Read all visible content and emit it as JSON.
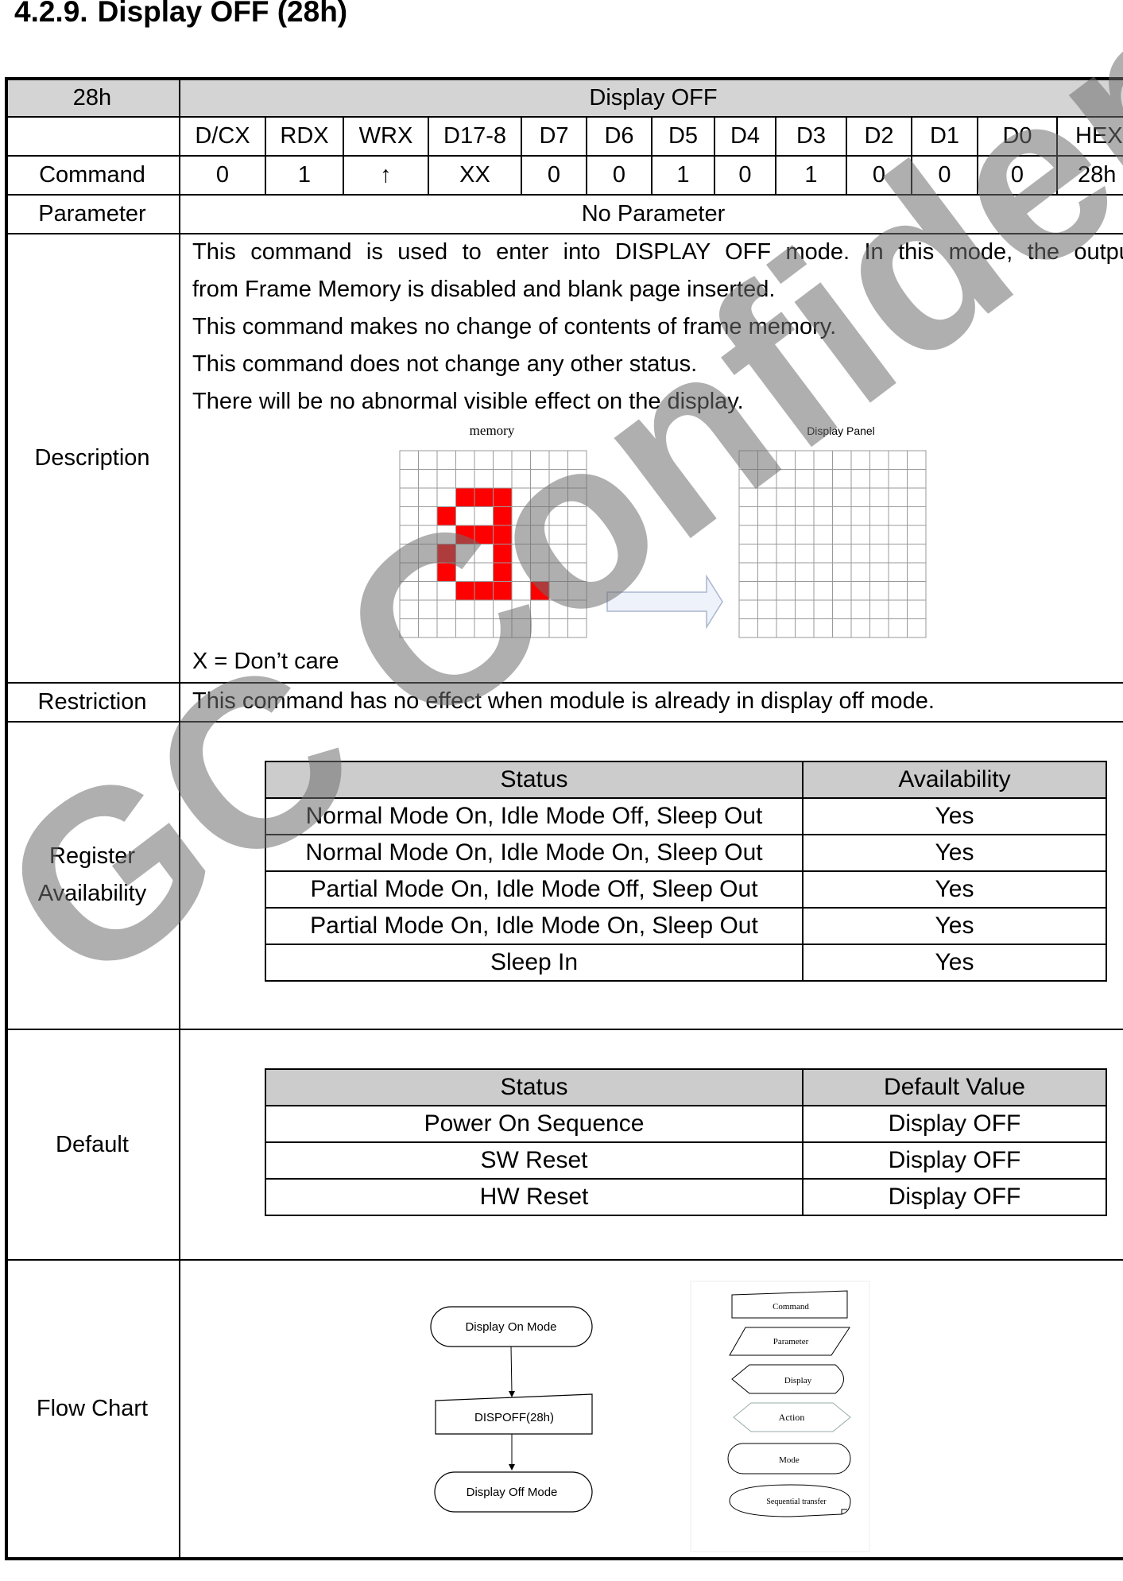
{
  "heading": {
    "number": "4.2.9.",
    "title": "Display OFF (28h)"
  },
  "header_row": {
    "code": "28h",
    "name": "Display OFF"
  },
  "bit_headers": [
    "D/CX",
    "RDX",
    "WRX",
    "D17-8",
    "D7",
    "D6",
    "D5",
    "D4",
    "D3",
    "D2",
    "D1",
    "D0",
    "HEX"
  ],
  "command_row": {
    "label": "Command",
    "values": [
      "0",
      "1",
      "↑",
      "XX",
      "0",
      "0",
      "1",
      "0",
      "1",
      "0",
      "0",
      "0",
      "28h"
    ]
  },
  "parameter_row": {
    "label": "Parameter",
    "value": "No Parameter"
  },
  "description": {
    "label": "Description",
    "lines": [
      "This command is used to enter into DISPLAY OFF mode. In this mode, the output",
      "from Frame Memory is disabled and blank page inserted.",
      "This command makes no change of contents of frame memory.",
      "This command does not change any other status.",
      "There will be no abnormal visible effect on the display."
    ],
    "memory_label": "memory",
    "panel_label": "Display Panel",
    "note": "X = Don’t care",
    "accent_color": "#ff0000"
  },
  "restriction": {
    "label": "Restriction",
    "text": "This command has no effect when module is already in display off mode."
  },
  "register_availability": {
    "label_line1": "Register",
    "label_line2": "Availability",
    "headers": [
      "Status",
      "Availability"
    ],
    "rows": [
      [
        "Normal Mode On, Idle Mode Off, Sleep Out",
        "Yes"
      ],
      [
        "Normal Mode On, Idle Mode On, Sleep Out",
        "Yes"
      ],
      [
        "Partial Mode On, Idle Mode Off, Sleep Out",
        "Yes"
      ],
      [
        "Partial Mode On, Idle Mode On, Sleep Out",
        "Yes"
      ],
      [
        "Sleep In",
        "Yes"
      ]
    ]
  },
  "default": {
    "label": "Default",
    "headers": [
      "Status",
      "Default Value"
    ],
    "rows": [
      [
        "Power On Sequence",
        "Display OFF"
      ],
      [
        "SW Reset",
        "Display OFF"
      ],
      [
        "HW Reset",
        "Display OFF"
      ]
    ]
  },
  "flow_chart": {
    "label": "Flow Chart",
    "nodes": [
      "Display On Mode",
      "DISPOFF(28h)",
      "Display Off  Mode"
    ],
    "legend": [
      "Command",
      "Parameter",
      "Display",
      "Action",
      "Mode",
      "Sequential transfer"
    ]
  },
  "watermark": "GC Confidential"
}
